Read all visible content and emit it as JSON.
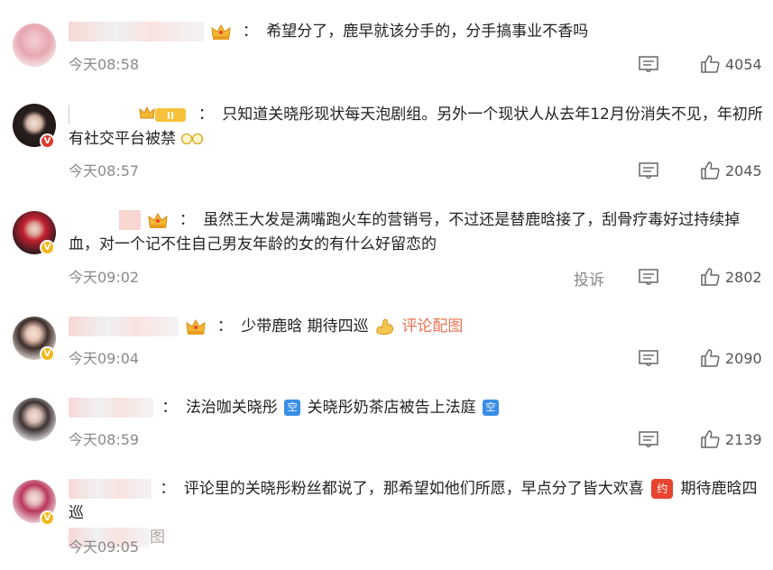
{
  "comments": [
    {
      "text": "希望分了，鹿早就该分手的，分手搞事业不香吗",
      "time": "今天08:58",
      "likes": "4054",
      "badge": "none"
    },
    {
      "text": "只知道关晓彤现状每天泡剧组。另外一个现状人从去年12月份消失不见，年初所有社交平台被禁",
      "time": "今天08:57",
      "likes": "2045",
      "badge": "red-v"
    },
    {
      "text": "虽然王大发是满嘴跑火车的营销号，不过还是替鹿晗接了，刮骨疗毒好过持续掉血，对一个记不住自己男友年龄的女的有什么好留恋的",
      "time": "今天09:02",
      "likes": "2802",
      "report": "投诉",
      "badge": "yellow-v"
    },
    {
      "text_before": "少带鹿晗 期待四巡",
      "link": "评论配图",
      "time": "今天09:04",
      "likes": "2090",
      "badge": "yellow-v"
    },
    {
      "text_part1": "法治咖关晓彤",
      "text_part2": "关晓彤奶茶店被告上法庭",
      "tag": "空",
      "time": "今天08:59",
      "likes": "2139",
      "badge": "none"
    },
    {
      "text_before": "评论里的关晓彤粉丝都说了，那希望如他们所愿，早点分了皆大欢喜",
      "tag": "约",
      "text_after": "期待鹿晗四巡",
      "link_tail": "图",
      "time": "今天09:05",
      "badge": "yellow-v"
    }
  ],
  "level_badge": "II",
  "colon": "："
}
